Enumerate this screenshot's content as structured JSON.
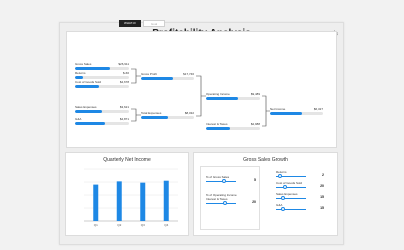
{
  "title": "Profitability Analysis",
  "tabs": [
    {
      "label": "WHAT-IF",
      "active": true
    },
    {
      "label": "Goal",
      "active": false
    }
  ],
  "tree": {
    "gross_sales": {
      "label": "Gross Sales",
      "value": "$26,911",
      "fill": 0.65
    },
    "returns": {
      "label": "Returns",
      "value": "$-66",
      "fill": 0.15
    },
    "cogs": {
      "label": "Cost of Goods Sold",
      "value": "$4,678",
      "fill": 0.45
    },
    "gross_profit": {
      "label": "Gross Profit",
      "value": "$17,746",
      "fill": 0.6
    },
    "sales_expenses": {
      "label": "Sales Expenses",
      "value": "$3,621",
      "fill": 0.5
    },
    "g_and_a": {
      "label": "G&A",
      "value": "$4,871",
      "fill": 0.55
    },
    "total_expenses": {
      "label": "Total Expenses",
      "value": "$8,032",
      "fill": 0.5
    },
    "operating_income": {
      "label": "Operating Income",
      "value": "$9,489",
      "fill": 0.6
    },
    "interest_taxes": {
      "label": "Interest & Taxes",
      "value": "$2,988",
      "fill": 0.45
    },
    "net_income": {
      "label": "Net Income",
      "value": "$6,327",
      "fill": 0.6
    }
  },
  "quarterly_chart": {
    "title": "Quarterly Net Income",
    "colors": {
      "bar": "#1e88e5",
      "grid": "#e6e6e6",
      "axis": "#999999"
    }
  },
  "chart_data": {
    "type": "bar",
    "title": "Quarterly Net Income",
    "categories": [
      "Q1",
      "Q2",
      "Q3",
      "Q4"
    ],
    "values": [
      5.6,
      6.1,
      5.9,
      6.2
    ],
    "ylim": [
      0,
      8
    ],
    "grid": true
  },
  "gross_sales_growth": {
    "title": "Gross Sales Growth",
    "left_sliders": [
      {
        "label": "% of Gross Sales",
        "value": "5",
        "fill": 0.6
      },
      {
        "label": "% of Operating Income",
        "sub": "Interest & Taxes",
        "value": "20",
        "fill": 0.65
      }
    ],
    "right_sliders": [
      {
        "label": "Returns",
        "value": "2",
        "fill": 0.1
      },
      {
        "label": "Cost of Goods Sold",
        "value": "20",
        "fill": 0.3
      },
      {
        "label": "Sales Expenses",
        "value": "15",
        "fill": 0.25
      },
      {
        "label": "G&A",
        "value": "15",
        "fill": 0.25
      }
    ]
  }
}
